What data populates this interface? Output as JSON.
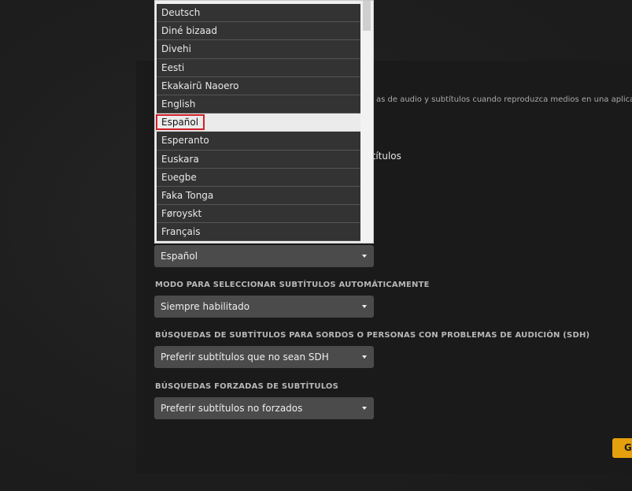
{
  "panel": {
    "description": "as de audio y subtítulos cuando reproduzca medios en una aplicación Ple",
    "subtitles_fragment": "btítulos"
  },
  "language_dropdown": {
    "items": [
      {
        "label": "Deutsch"
      },
      {
        "label": "Diné bizaad"
      },
      {
        "label": "Divehi"
      },
      {
        "label": "Eesti"
      },
      {
        "label": "Ekakairũ Naoero"
      },
      {
        "label": "English"
      },
      {
        "label": "Español"
      },
      {
        "label": "Esperanto"
      },
      {
        "label": "Euskara"
      },
      {
        "label": "Eʋegbe"
      },
      {
        "label": "Faka Tonga"
      },
      {
        "label": "Føroyskt"
      },
      {
        "label": "Français"
      }
    ],
    "selected_index": 6
  },
  "subtitle_language_select": {
    "value": "Español"
  },
  "auto_mode": {
    "label": "MODO PARA SELECCIONAR SUBTÍTULOS AUTOMÁTICAMENTE",
    "value": "Siempre habilitado"
  },
  "sdh": {
    "label": "BÚSQUEDAS DE SUBTÍTULOS PARA SORDOS O PERSONAS CON PROBLEMAS DE AUDICIÓN (SDH)",
    "value": "Preferir subtítulos que no sean SDH"
  },
  "forced": {
    "label": "BÚSQUEDAS FORZADAS DE SUBTÍTULOS",
    "value": "Preferir subtítulos no forzados"
  },
  "save_button": {
    "label": "G"
  },
  "colors": {
    "accent": "#e5a00d",
    "selection_border": "#d0202a",
    "select_bg": "#4b4b4b",
    "panel_bg": "#1a1a1a"
  }
}
